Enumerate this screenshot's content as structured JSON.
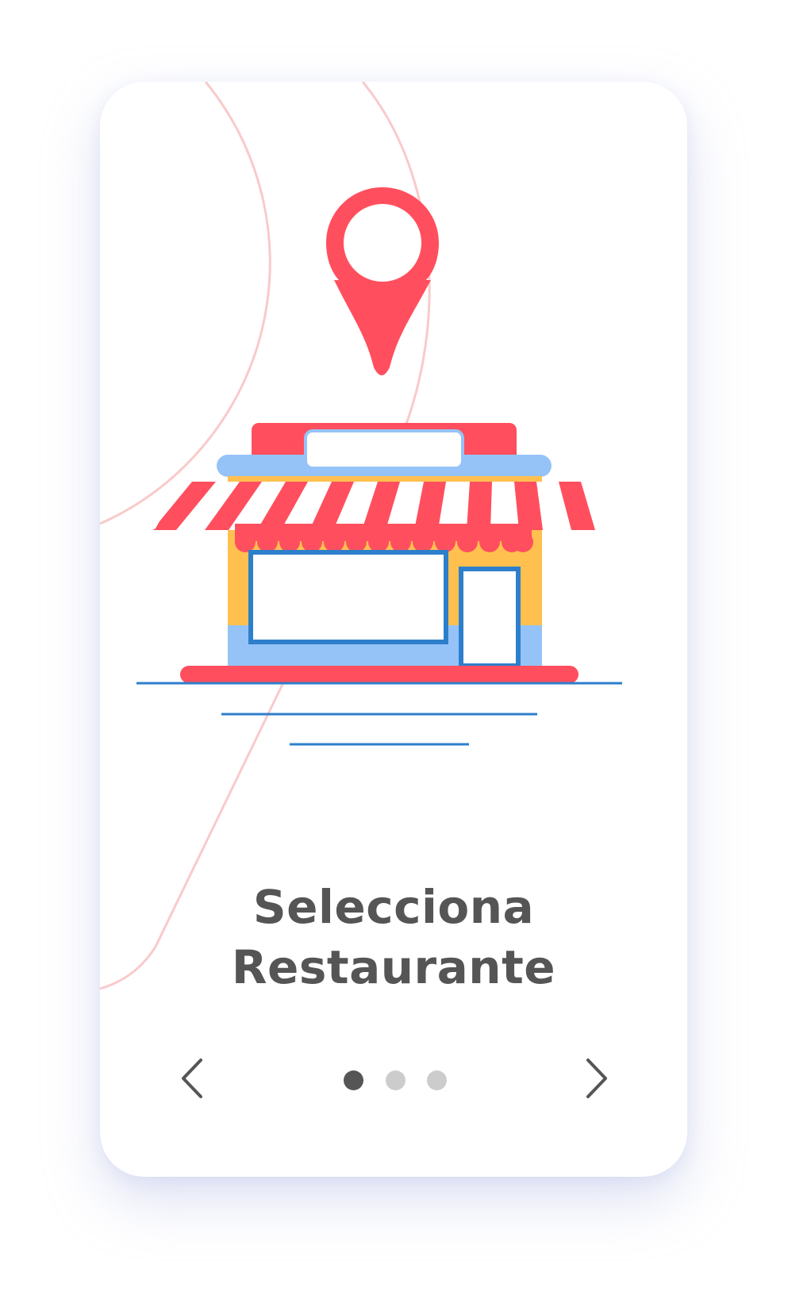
{
  "onboarding": {
    "title_line1": "Selecciona",
    "title_line2": "Restaurante",
    "illustration": {
      "pin_icon": "location-pin-icon",
      "store_icon": "storefront-icon"
    },
    "navigation": {
      "prev_icon": "chevron-left-icon",
      "next_icon": "chevron-right-icon",
      "pages": 3,
      "current_page": 1
    }
  },
  "colors": {
    "title": "#555555",
    "accent_red": "#ff4f5e",
    "store_yellow": "#ffc04f",
    "store_light_blue": "#95c3f8",
    "store_blue": "#2e7fcb",
    "route_line": "#f9caca",
    "dot_active": "#555555",
    "dot_inactive": "#cccccc",
    "card_shadow": "#aab4e1"
  }
}
